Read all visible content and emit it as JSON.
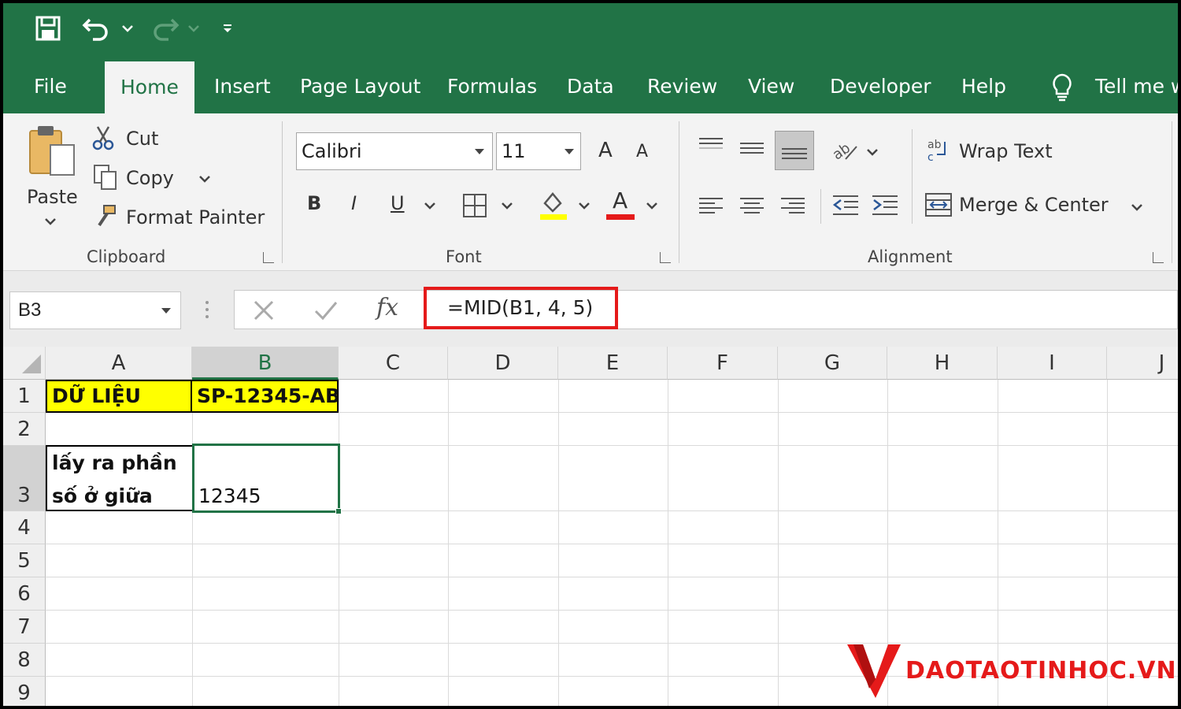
{
  "qat": {
    "save_icon": "save-icon",
    "undo_icon": "undo-icon",
    "redo_icon": "redo-icon",
    "customize_icon": "customize-qat-icon"
  },
  "tabs": [
    "File",
    "Home",
    "Insert",
    "Page Layout",
    "Formulas",
    "Data",
    "Review",
    "View",
    "Developer",
    "Help"
  ],
  "tell_me": "Tell me w",
  "clipboard": {
    "paste": "Paste",
    "cut": "Cut",
    "copy": "Copy",
    "format_painter": "Format Painter",
    "group_label": "Clipboard"
  },
  "font": {
    "name": "Calibri",
    "size": "11",
    "bold": "B",
    "italic": "I",
    "underline": "U",
    "grow": "A",
    "shrink": "A",
    "color_letter": "A",
    "group_label": "Font",
    "highlight_color": "#ffff00",
    "font_color": "#e51a1a"
  },
  "alignment": {
    "wrap_text": "Wrap Text",
    "merge_center": "Merge & Center",
    "group_label": "Alignment"
  },
  "formula_bar": {
    "name_box": "B3",
    "fx": "fx",
    "formula": "=MID(B1, 4, 5)"
  },
  "columns": [
    "A",
    "B",
    "C",
    "D",
    "E",
    "F",
    "G",
    "H",
    "I",
    "J"
  ],
  "rows": [
    "1",
    "2",
    "3",
    "4",
    "5",
    "6",
    "7",
    "8",
    "9"
  ],
  "cells": {
    "A1": "DỮ LIỆU",
    "B1": "SP-12345-AB",
    "A3_line1": "lấy ra phần",
    "A3_line2": "số ở giữa",
    "B3": "12345"
  },
  "watermark": {
    "text": "DAOTAOTINHOC.VN",
    "color": "#e51a1a"
  },
  "colors": {
    "excel_green": "#217346",
    "highlight_yellow": "#ffff00",
    "callout_red": "#e51a1a"
  }
}
